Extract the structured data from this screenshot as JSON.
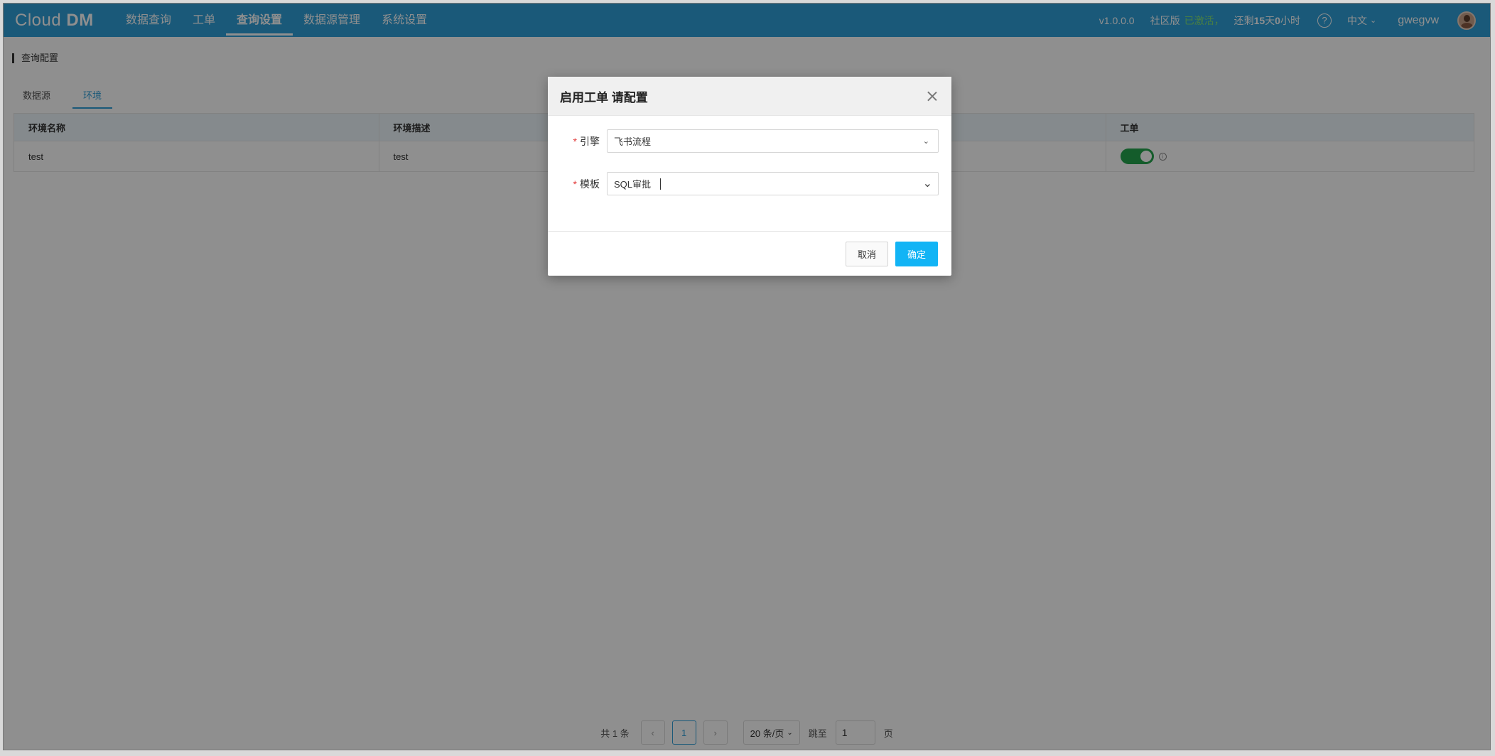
{
  "header": {
    "logo_text": "Cloud",
    "logo_bold": "DM",
    "nav": [
      "数据查询",
      "工单",
      "查询设置",
      "数据源管理",
      "系统设置"
    ],
    "version": "v1.0.0.0",
    "edition": "社区版",
    "activated": "已激活，",
    "remain_prefix": "还剩",
    "remain_days": "15",
    "remain_days_unit": "天",
    "remain_hours": "0",
    "remain_hours_unit": "小时",
    "help": "?",
    "language": "中文",
    "username": "gwegvw"
  },
  "page": {
    "title": "查询配置",
    "tabs": [
      "数据源",
      "环境"
    ],
    "table": {
      "columns": [
        "环境名称",
        "环境描述",
        "工单"
      ],
      "rows": [
        {
          "name": "test",
          "description": "test",
          "workorder_enabled": true
        }
      ]
    },
    "pagination": {
      "total": "共 1 条",
      "prev": "‹",
      "current": "1",
      "next": "›",
      "page_size": "20 条/页",
      "jump_label": "跳至",
      "jump_value": "1",
      "jump_suffix": "页"
    }
  },
  "modal": {
    "title": "启用工单 请配置",
    "engine_label": "引擎",
    "engine_value": "飞书流程",
    "template_label": "模板",
    "template_value": "SQL审批",
    "cancel": "取消",
    "confirm": "确定"
  },
  "colors": {
    "primary": "#2f9fd8",
    "confirm_button": "#12b4f5",
    "toggle_on": "#25a54e",
    "required": "#e23b3b"
  }
}
